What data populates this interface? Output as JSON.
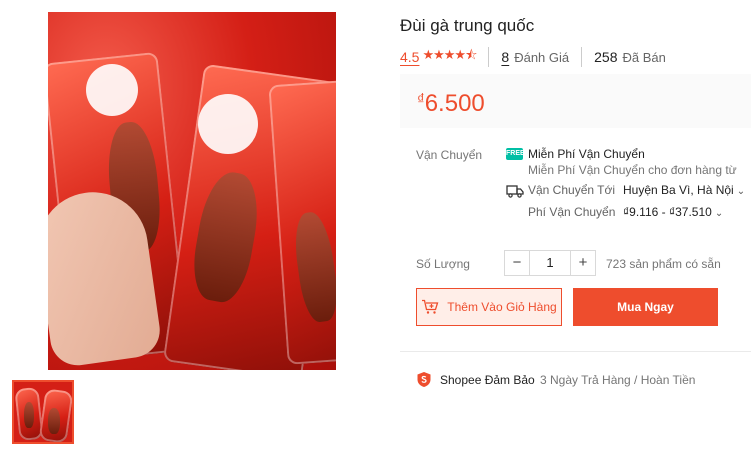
{
  "product": {
    "title": "Đùi gà trung quốc",
    "rating": "4.5",
    "stars": "★★★★⯪",
    "reviews_count": "8",
    "reviews_label": "Đánh Giá",
    "sold_count": "258",
    "sold_label": "Đã Bán",
    "currency": "₫",
    "price": "6.500"
  },
  "shipping": {
    "label": "Vận Chuyển",
    "free_badge": "FREE",
    "free_title": "Miễn Phí Vận Chuyển",
    "free_subtitle": "Miễn Phí Vận Chuyển cho đơn hàng từ",
    "to_label": "Vận Chuyển Tới",
    "to_value": "Huyện Ba Vì, Hà Nội",
    "fee_label": "Phí Vận Chuyển",
    "fee_value": "₫9.116 - ₫37.510"
  },
  "quantity": {
    "label": "Số Lượng",
    "minus": "−",
    "value": "1",
    "plus": "+",
    "stock": "723 sản phẩm có sẵn"
  },
  "actions": {
    "add_to_cart": "Thêm Vào Giỏ Hàng",
    "buy_now": "Mua Ngay"
  },
  "guarantee": {
    "label": "Shopee Đảm Bảo",
    "text": "3 Ngày Trả Hàng / Hoàn Tiền"
  },
  "colors": {
    "accent": "#ee4d2d",
    "free_shipping": "#00bfa5"
  },
  "icons": [
    "free-shipping-icon",
    "truck-icon",
    "chevron-down-icon",
    "cart-plus-icon",
    "shield-icon"
  ]
}
